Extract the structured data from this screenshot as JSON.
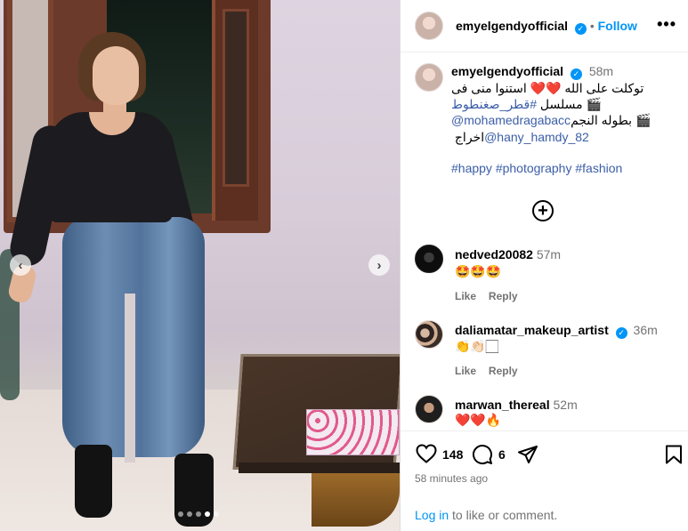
{
  "post": {
    "author": "emyelgendyofficial",
    "follow_label": "Follow",
    "more_label": "•••",
    "caption_time": "58m",
    "caption_line1": "توكلت على الله ❤️❤️ استنوا منى فى",
    "caption_line2_prefix": "🎬 مسلسل ",
    "caption_line2_tag": "#قطر_صغنطوط",
    "caption_line3_prefix": "🎬 بطوله النجم ",
    "caption_line3_tag": "@mohamedragabacc",
    "caption_line4_prefix": "اخراج ",
    "caption_line4_tag": "@hany_hamdy_82",
    "hashtags": [
      "#happy",
      "#photography",
      "#fashion"
    ],
    "load_more_label": "⊕"
  },
  "comments": [
    {
      "user": "nedved20082",
      "time": "57m",
      "text": "🤩🤩🤩",
      "verified": false,
      "like": "Like",
      "reply": "Reply"
    },
    {
      "user": "daliamatar_makeup_artist",
      "time": "36m",
      "text": "👏👏🏻🏻",
      "verified": true,
      "like": "Like",
      "reply": "Reply"
    },
    {
      "user": "marwan_thereal",
      "time": "52m",
      "text": "❤️❤️🔥",
      "verified": false
    }
  ],
  "actions": {
    "likes": "148",
    "comments": "6",
    "posted": "58 minutes ago",
    "login_link": "Log in",
    "login_text": " to like or comment."
  },
  "carousel": {
    "prev": "‹",
    "next": "›",
    "slides": 5,
    "active_index": 3
  },
  "icons": [
    "heart-icon",
    "comment-icon",
    "share-icon",
    "bookmark-icon",
    "verified-icon",
    "plus-circle-icon"
  ],
  "colors": {
    "link": "#0095f6",
    "tag": "#3b5ea8",
    "muted": "#737373"
  }
}
